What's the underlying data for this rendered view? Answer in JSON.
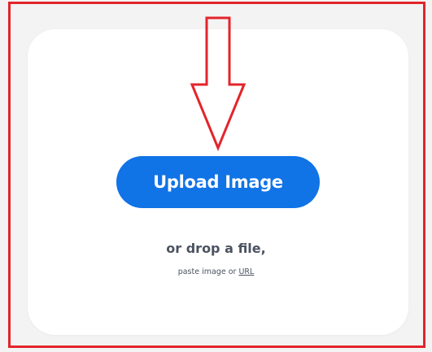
{
  "upload": {
    "button_label": "Upload Image",
    "drop_text": "or drop a file,",
    "paste_text": "paste image or",
    "url_link": "URL"
  },
  "colors": {
    "button_bg": "#1073e6",
    "annotation_red": "#e3242b"
  },
  "icons": {
    "annotation_arrow": "arrow-down-outline"
  }
}
